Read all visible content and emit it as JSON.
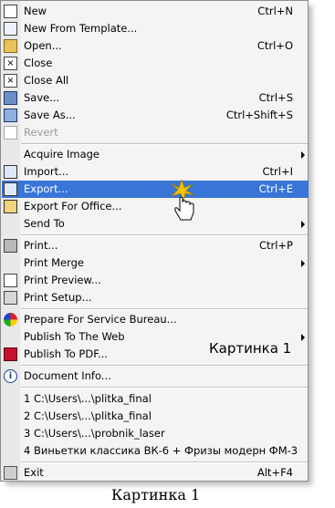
{
  "menu": {
    "items": [
      {
        "label": "New",
        "shortcut": "Ctrl+N",
        "icon": "new-document-icon",
        "disabled": false
      },
      {
        "label": "New From Template...",
        "shortcut": "",
        "icon": "template-icon",
        "disabled": false
      },
      {
        "label": "Open...",
        "shortcut": "Ctrl+O",
        "icon": "open-folder-icon",
        "disabled": false
      },
      {
        "label": "Close",
        "shortcut": "",
        "icon": "close-document-icon",
        "disabled": false
      },
      {
        "label": "Close All",
        "shortcut": "",
        "icon": "close-all-icon",
        "disabled": false
      },
      {
        "label": "Save...",
        "shortcut": "Ctrl+S",
        "icon": "save-icon",
        "disabled": false
      },
      {
        "label": "Save As...",
        "shortcut": "Ctrl+Shift+S",
        "icon": "save-as-icon",
        "disabled": false
      },
      {
        "label": "Revert",
        "shortcut": "",
        "icon": "revert-icon",
        "disabled": true
      },
      {
        "label": "Acquire Image",
        "shortcut": "",
        "icon": "",
        "submenu": true
      },
      {
        "label": "Import...",
        "shortcut": "Ctrl+I",
        "icon": "import-icon"
      },
      {
        "label": "Export...",
        "shortcut": "Ctrl+E",
        "icon": "export-icon",
        "highlight": true
      },
      {
        "label": "Export For Office...",
        "shortcut": "",
        "icon": "export-office-icon"
      },
      {
        "label": "Send To",
        "shortcut": "",
        "icon": "",
        "submenu": true
      },
      {
        "label": "Print...",
        "shortcut": "Ctrl+P",
        "icon": "printer-icon"
      },
      {
        "label": "Print Merge",
        "shortcut": "",
        "icon": "",
        "submenu": true
      },
      {
        "label": "Print Preview...",
        "shortcut": "",
        "icon": "print-preview-icon"
      },
      {
        "label": "Print Setup...",
        "shortcut": "",
        "icon": "print-setup-icon"
      },
      {
        "label": "Prepare For Service Bureau...",
        "shortcut": "",
        "icon": "service-bureau-icon"
      },
      {
        "label": "Publish To The Web",
        "shortcut": "",
        "icon": "",
        "submenu": true
      },
      {
        "label": "Publish To PDF...",
        "shortcut": "",
        "icon": "pdf-icon"
      },
      {
        "label": "Document Info...",
        "shortcut": "",
        "icon": "info-icon"
      },
      {
        "label": "1 C:\\Users\\...\\plitka_final",
        "shortcut": "",
        "icon": ""
      },
      {
        "label": "2 C:\\Users\\...\\plitka_final",
        "shortcut": "",
        "icon": ""
      },
      {
        "label": "3 C:\\Users\\...\\probnik_laser",
        "shortcut": "",
        "icon": ""
      },
      {
        "label": "4 Виньетки классика ВК-6 + Фризы модерн ФМ-3",
        "shortcut": "",
        "icon": ""
      },
      {
        "label": "Exit",
        "shortcut": "Alt+F4",
        "icon": "exit-icon"
      }
    ]
  },
  "caption_inner": "Картинка 1",
  "caption_outer": "Картинка 1",
  "colors": {
    "highlight": "#3875d7"
  }
}
